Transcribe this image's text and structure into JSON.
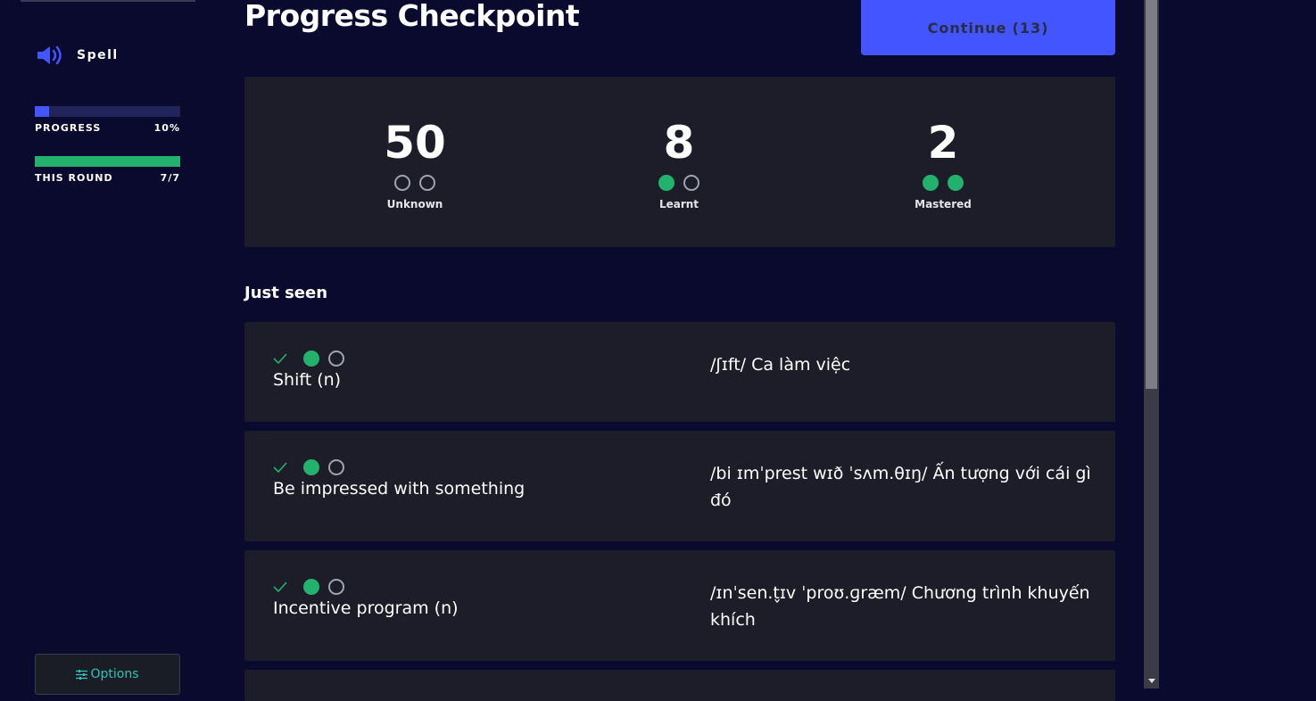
{
  "sidebar": {
    "mode_label": "Spell",
    "progress": {
      "label": "PROGRESS",
      "value_text": "10%",
      "fill": 0.1,
      "color": "#4255ff"
    },
    "round": {
      "label": "THIS ROUND",
      "value_text": "7/7",
      "fill": 1.0,
      "color": "#23b26d"
    },
    "options_label": "Options"
  },
  "header": {
    "title": "Progress Checkpoint",
    "continue_label": "Continue",
    "continue_count": "(13)"
  },
  "summary": [
    {
      "number": "50",
      "caption": "Unknown",
      "dots": [
        "empty",
        "empty"
      ]
    },
    {
      "number": "8",
      "caption": "Learnt",
      "dots": [
        "filled",
        "empty"
      ]
    },
    {
      "number": "2",
      "caption": "Mastered",
      "dots": [
        "filled",
        "filled"
      ]
    }
  ],
  "just_seen": {
    "heading": "Just seen",
    "items": [
      {
        "term": "Shift (n)",
        "definition": "/ʃɪft/ Ca làm việc",
        "dots": [
          "filled",
          "empty"
        ],
        "correct": true
      },
      {
        "term": "Be impressed with something",
        "definition": "/bi ɪmˈprest wɪð ˈsʌm.θɪŋ/ Ấn tượng với cái gì đó",
        "dots": [
          "filled",
          "empty"
        ],
        "correct": true
      },
      {
        "term": "Incentive program (n)",
        "definition": "/ɪnˈsen.t̬ɪv ˈproʊ.ɡræm/ Chương trình khuyến khích",
        "dots": [
          "filled",
          "empty"
        ],
        "correct": true
      }
    ]
  },
  "colors": {
    "background": "#0a0a2e",
    "card": "#1c1d28",
    "accent": "#4255ff",
    "success": "#23b26d",
    "options_text": "#2ec4b6"
  }
}
